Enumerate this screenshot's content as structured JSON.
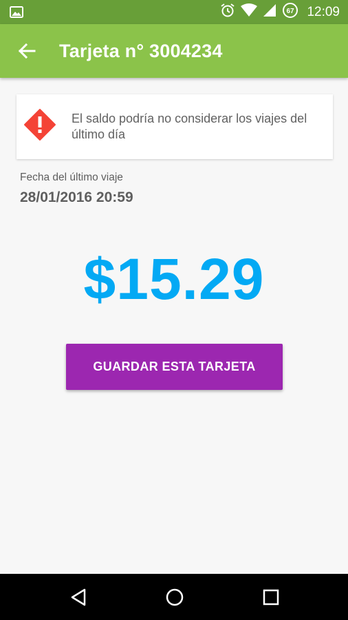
{
  "status_bar": {
    "time": "12:09",
    "battery_level": "67",
    "icons": [
      "image-icon",
      "alarm-icon",
      "wifi-icon",
      "signal-icon",
      "battery-icon"
    ]
  },
  "app_bar": {
    "title": "Tarjeta n° 3004234",
    "background_color": "#8bc34a",
    "status_color": "#689f38"
  },
  "warning": {
    "message": "El saldo podría no considerar los viajes del último día",
    "icon": "warning-diamond-icon",
    "icon_color": "#f44336"
  },
  "last_trip": {
    "label": "Fecha del último viaje",
    "value": "28/01/2016 20:59"
  },
  "balance": {
    "amount": "$15.29",
    "color": "#03a9f4"
  },
  "actions": {
    "save_label": "GUARDAR ESTA TARJETA",
    "save_color": "#9c27b0"
  },
  "nav": {
    "icons": [
      "nav-back-icon",
      "nav-home-icon",
      "nav-recent-icon"
    ]
  }
}
